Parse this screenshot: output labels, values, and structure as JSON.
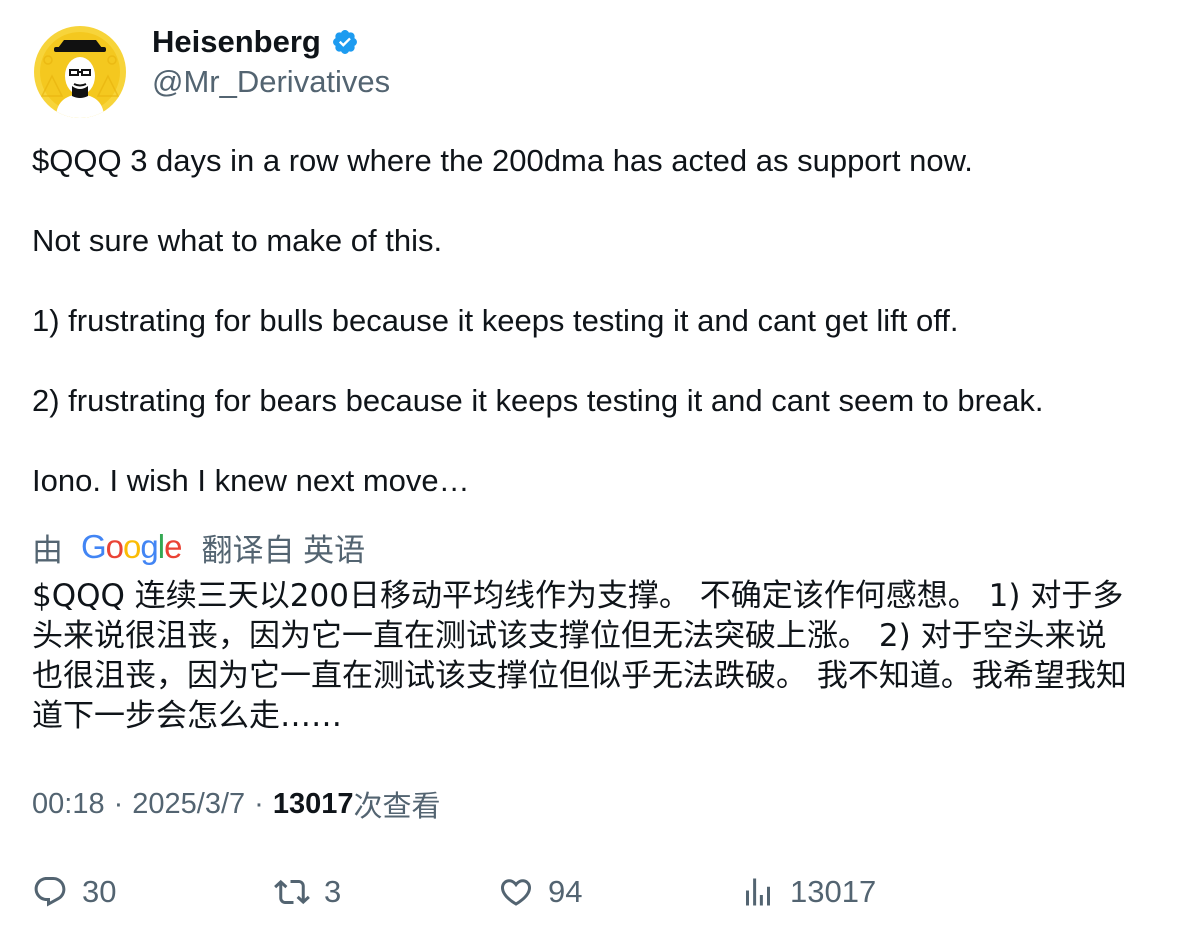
{
  "author": {
    "display_name": "Heisenberg",
    "handle": "@Mr_Derivatives",
    "verified_icon": "verified-badge-icon",
    "avatar": "heisenberg-avatar"
  },
  "tweet": {
    "paragraphs": [
      "$QQQ 3 days in a row where the 200dma has acted as support now.",
      "Not sure what to make of this.",
      "1) frustrating for bulls because it keeps testing it and cant get lift off.",
      "2) frustrating for bears because it keeps testing it and cant seem to break.",
      "Iono. I wish I knew next move…"
    ]
  },
  "translation": {
    "by_label": "由",
    "google_logo": "Google",
    "from_label": "翻译自 英语",
    "lines": [
      "$QQQ 连续三天以200日移动平均线作为支撑。 不确定该作何感想。 1) 对于多",
      "头来说很沮丧，因为它一直在测试该支撑位但无法突破上涨。 2) 对于空头来说",
      "也很沮丧，因为它一直在测试该支撑位但似乎无法跌破。 我不知道。我希望我知",
      "道下一步会怎么走……"
    ]
  },
  "meta": {
    "time": "00:18",
    "separator": "·",
    "date": "2025/3/7",
    "views_count": "13017",
    "views_label": "次查看"
  },
  "actions": {
    "reply_count": "30",
    "retweet_count": "3",
    "like_count": "94",
    "views_count": "13017"
  },
  "colors": {
    "text_primary": "#0f1419",
    "text_secondary": "#536471",
    "verified_blue": "#1d9bf0",
    "avatar_yellow": "#f7d43a"
  }
}
